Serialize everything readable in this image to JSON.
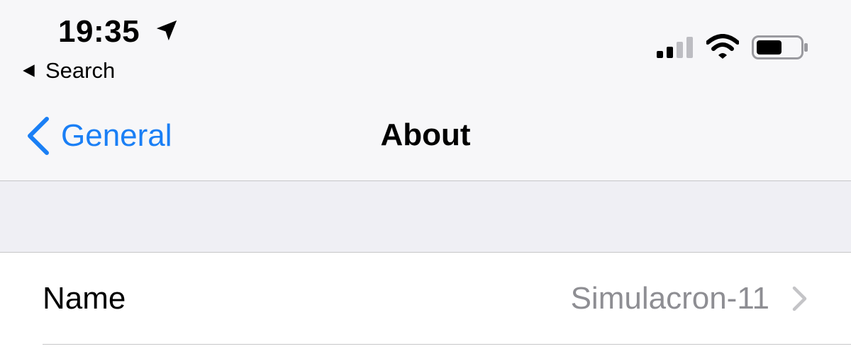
{
  "status_bar": {
    "time": "19:35",
    "back_app_label": "Search",
    "icons": [
      "location-arrow-icon",
      "back-triangle-icon",
      "cellular-signal-icon",
      "wifi-icon",
      "battery-icon"
    ],
    "signal_bars_active": 2,
    "signal_bars_total": 4,
    "battery_level": 0.6
  },
  "nav": {
    "back_label": "General",
    "title": "About",
    "back_icon": "chevron-left-icon"
  },
  "rows": [
    {
      "label": "Name",
      "value": "Simulacron-11",
      "icon": "chevron-right-icon"
    }
  ],
  "colors": {
    "accent": "#1a7ff5",
    "secondary_text": "#8e8e93",
    "grouped_background": "#efeff4",
    "separator": "#c6c6c8"
  }
}
